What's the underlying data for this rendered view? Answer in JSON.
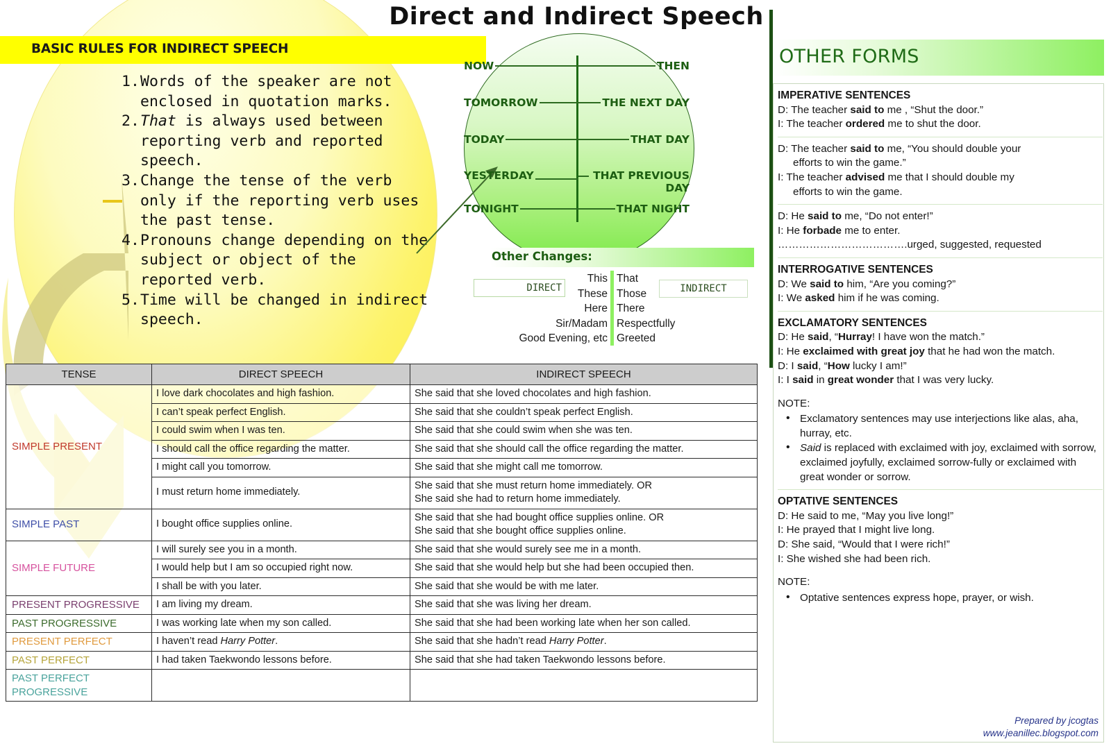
{
  "title": "Direct and Indirect Speech",
  "banner": {
    "label": "BASIC RULES FOR INDIRECT SPEECH"
  },
  "rules": [
    {
      "num": "1.",
      "text": "Words of the speaker are not enclosed in quotation marks."
    },
    {
      "num": "2.",
      "italic_lead": "That",
      "text": " is always used between reporting verb and reported speech."
    },
    {
      "num": "3.",
      "text": "Change the tense of the verb only if the reporting verb uses the past tense."
    },
    {
      "num": "4.",
      "text": "Pronouns change depending on the subject or object of the reported verb."
    },
    {
      "num": "5.",
      "text": "Time will be changed in indirect speech."
    }
  ],
  "time_circle": {
    "rows": [
      {
        "direct": "NOW",
        "indirect": "THEN"
      },
      {
        "direct": "TOMORROW",
        "indirect": "THE NEXT DAY"
      },
      {
        "direct": "TODAY",
        "indirect": "THAT DAY"
      },
      {
        "direct": "YESTERDAY",
        "indirect": "THAT PREVIOUS DAY"
      },
      {
        "direct": "TONIGHT",
        "indirect": "THAT NIGHT"
      }
    ]
  },
  "other_changes": {
    "title": "Other Changes:",
    "direct_box": "DIRECT",
    "indirect_box": "INDIRECT",
    "left": [
      "This",
      "These",
      "Here",
      "Sir/Madam",
      "Good Evening, etc"
    ],
    "right": [
      "That",
      "Those",
      "There",
      "Respectfully",
      "Greeted"
    ]
  },
  "table": {
    "headers": [
      "TENSE",
      "DIRECT SPEECH",
      "INDIRECT SPEECH"
    ],
    "groups": [
      {
        "tense": "SIMPLE PRESENT",
        "tense_color": "#c0392b",
        "rows": [
          {
            "direct": "I  love dark chocolates and high fashion.",
            "indirect": "She said that she loved chocolates and high fashion."
          },
          {
            "direct": "I can’t speak perfect English.",
            "indirect": "She said that she couldn’t speak perfect English."
          },
          {
            "direct": "I could swim when I was ten.",
            "indirect": "She said that she could swim when she was ten."
          },
          {
            "direct": "I should call the office regarding the matter.",
            "indirect": "She said that she should call the office regarding the matter."
          },
          {
            "direct": "I might call you tomorrow.",
            "indirect": "She said that she might call me tomorrow."
          },
          {
            "direct": "I must return home immediately.",
            "indirect": "She said that she must return home immediately.  OR\nShe said she had to return home immediately."
          }
        ]
      },
      {
        "tense": "SIMPLE PAST",
        "tense_color": "#3f4fa8",
        "rows": [
          {
            "direct": "I bought office supplies online.",
            "indirect": "She said that she had bought office supplies online.   OR\nShe said that she bought office supplies online."
          }
        ]
      },
      {
        "tense": "SIMPLE FUTURE",
        "tense_color": "#d6529e",
        "rows": [
          {
            "direct": "I will surely see you in a month.",
            "indirect": "She said that she would surely see me in a month."
          },
          {
            "direct": "I would help but I am so occupied right now.",
            "indirect": "She said that she would help but she had been occupied then."
          },
          {
            "direct": "I shall be with you later.",
            "indirect": "She said that she would be with me later."
          }
        ]
      },
      {
        "tense": "PRESENT PROGRESSIVE",
        "tense_color": "#7a3f6e",
        "rows": [
          {
            "direct": "I am living my dream.",
            "indirect": "She said that she was living her dream."
          }
        ]
      },
      {
        "tense": "PAST PROGRESSIVE",
        "tense_color": "#3c6b2d",
        "rows": [
          {
            "direct": "I was working late when my son called.",
            "indirect": "She said that she had been working late when her son called."
          }
        ]
      },
      {
        "tense": "PRESENT PERFECT",
        "tense_color": "#e09a3e",
        "rows": [
          {
            "direct": "I haven’t read Harry Potter.",
            "indirect": "She said that she hadn’t read Harry Potter."
          }
        ]
      },
      {
        "tense": "PAST PERFECT",
        "tense_color": "#b5a43a",
        "rows": [
          {
            "direct": "I had taken Taekwondo lessons before.",
            "indirect": "She said that she had taken Taekwondo lessons before."
          }
        ]
      },
      {
        "tense": "PAST PERFECT  PROGRESSIVE",
        "tense_color": "#4aa39c",
        "rows": [
          {
            "direct": "",
            "indirect": ""
          }
        ]
      }
    ]
  },
  "other_forms": {
    "title": "OTHER FORMS",
    "sections": [
      {
        "heading": "IMPERATIVE SENTENCES",
        "lines": [
          "D: The teacher said to me , “Shut the door.”",
          "I: The teacher ordered me to shut the door."
        ]
      },
      {
        "heading": "",
        "lines": [
          "D: The teacher said to me, “You should double your",
          "efforts to win the game.”",
          "I: The teacher advised me that I should double my",
          "efforts to win the game."
        ]
      },
      {
        "heading": "",
        "lines": [
          "D: He said to me, “Do not enter!”",
          "I: He forbade me to enter.",
          "……………………………….urged, suggested, requested"
        ]
      },
      {
        "heading": "INTERROGATIVE SENTENCES",
        "lines": [
          "D: We said to him, “Are you coming?”",
          "I: We asked him if he was coming."
        ]
      },
      {
        "heading": "EXCLAMATORY SENTENCES",
        "lines": [
          "D: He said, “Hurray! I have won the match.”",
          "I: He exclaimed with great joy that he had won the match.",
          "D: I said, “How lucky I am!”",
          "I: I said in great wonder that I was very lucky."
        ]
      }
    ],
    "note1_label": "NOTE:",
    "note1_bullets": [
      "Exclamatory sentences may use interjections like alas, aha, hurray, etc.",
      "Said is replaced with exclaimed with joy, exclaimed with sorrow, exclaimed joyfully, exclaimed sorrow-fully or exclaimed with great wonder or sorrow."
    ],
    "optative_heading": "OPTATIVE SENTENCES",
    "optative_lines": [
      "D: He said to me, “May you live long!”",
      "I: He prayed that I might live long.",
      "D: She said, “Would that I were rich!”",
      "I: She wished she had been rich."
    ],
    "note2_label": "NOTE:",
    "note2_bullets": [
      "Optative sentences express hope, prayer, or wish."
    ]
  },
  "credit": {
    "line1": "Prepared by jcogtas",
    "line2": "www.jeanillec.blogspot.com"
  },
  "colors": {
    "banner_yellow": "#ffff00",
    "green_dark": "#1d5e12",
    "green_light": "#8ef061",
    "accent_bar": "#1c4f14",
    "credit_blue": "#27348a"
  }
}
